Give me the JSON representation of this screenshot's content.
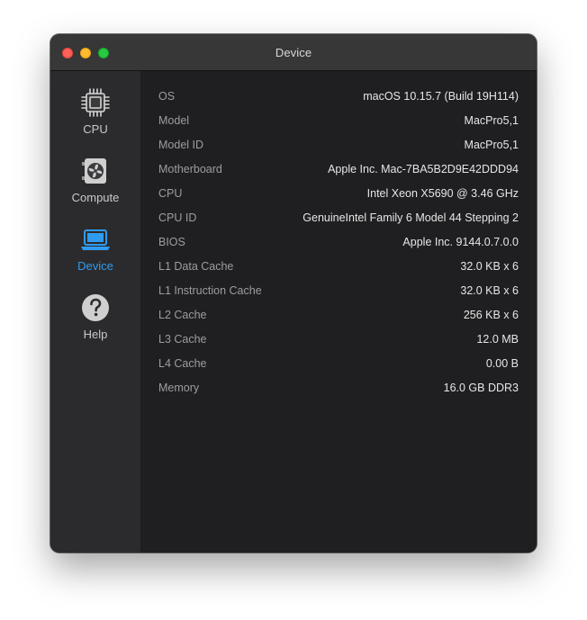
{
  "window": {
    "title": "Device"
  },
  "sidebar": {
    "items": [
      {
        "label": "CPU",
        "icon": "cpu-chip-icon",
        "active": false
      },
      {
        "label": "Compute",
        "icon": "gpu-fan-card-icon",
        "active": false
      },
      {
        "label": "Device",
        "icon": "laptop-icon",
        "active": true
      },
      {
        "label": "Help",
        "icon": "question-mark-circle-icon",
        "active": false
      }
    ]
  },
  "details": {
    "rows": [
      {
        "label": "OS",
        "value": "macOS 10.15.7 (Build 19H114)"
      },
      {
        "label": "Model",
        "value": "MacPro5,1"
      },
      {
        "label": "Model ID",
        "value": "MacPro5,1"
      },
      {
        "label": "Motherboard",
        "value": "Apple Inc. Mac-7BA5B2D9E42DDD94"
      },
      {
        "label": "CPU",
        "value": "Intel Xeon X5690 @ 3.46 GHz"
      },
      {
        "label": "CPU ID",
        "value": "GenuineIntel Family 6 Model 44 Stepping 2"
      },
      {
        "label": "BIOS",
        "value": "Apple Inc. 9144.0.7.0.0"
      },
      {
        "label": "L1 Data Cache",
        "value": "32.0 KB x 6"
      },
      {
        "label": "L1 Instruction Cache",
        "value": "32.0 KB x 6"
      },
      {
        "label": "L2 Cache",
        "value": "256 KB x 6"
      },
      {
        "label": "L3 Cache",
        "value": "12.0 MB"
      },
      {
        "label": "L4 Cache",
        "value": "0.00 B"
      },
      {
        "label": "Memory",
        "value": "16.0 GB DDR3"
      }
    ]
  },
  "colors": {
    "accent": "#2f9cf0",
    "close": "#fe5f57",
    "minimize": "#febc2e",
    "maximize": "#28c840"
  }
}
